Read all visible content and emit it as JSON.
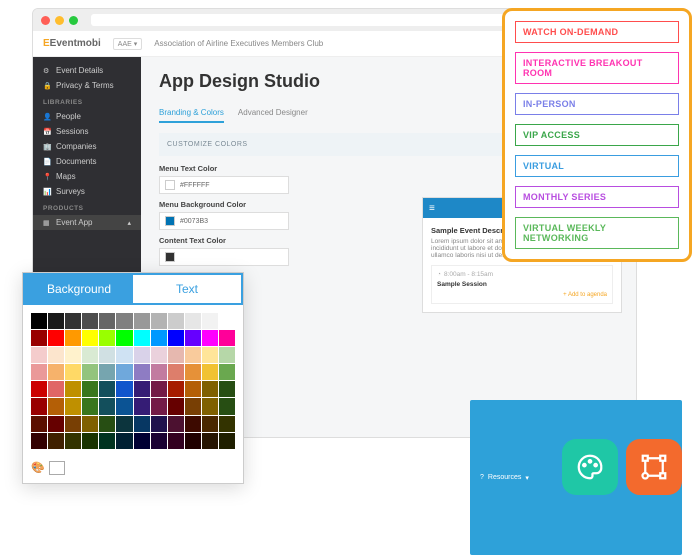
{
  "window": {
    "brand": "Eventmobi",
    "select": "AAE",
    "breadcrumb": "Association of Airline Executives Members Club"
  },
  "sidebar": {
    "items": [
      {
        "icon": "⚙",
        "label": "Event Details"
      },
      {
        "icon": "🔒",
        "label": "Privacy & Terms"
      }
    ],
    "sect1": "LIBRARIES",
    "lib": [
      {
        "icon": "👤",
        "label": "People"
      },
      {
        "icon": "📅",
        "label": "Sessions"
      },
      {
        "icon": "🏢",
        "label": "Companies"
      },
      {
        "icon": "📄",
        "label": "Documents"
      },
      {
        "icon": "📍",
        "label": "Maps"
      },
      {
        "icon": "📊",
        "label": "Surveys"
      }
    ],
    "sect2": "PRODUCTS",
    "prod": {
      "icon": "▦",
      "label": "Event App"
    }
  },
  "main": {
    "title": "App Design Studio",
    "tabs": [
      "Branding & Colors",
      "Advanced Designer"
    ],
    "panel": "CUSTOMIZE COLORS",
    "fields": [
      {
        "label": "Menu Text Color",
        "swatch": "#ffffff",
        "value": "#FFFFFF"
      },
      {
        "label": "Menu Background Color",
        "swatch": "#0073B3",
        "value": "#0073B3"
      },
      {
        "label": "Content Text Color",
        "swatch": "#333333",
        "value": ""
      }
    ]
  },
  "preview": {
    "title": "Sample Event Description",
    "lorem": "Lorem ipsum dolor sit amet, consectetur adipisicing elit, incididunt ut labore et dolore magna aliqua minim, exercitation ullamco laboris nisi ut de.",
    "time": "8:00am - 8:15am",
    "session": "Sample Session",
    "more": "+ Add to agenda"
  },
  "resources": "Resources",
  "picker": {
    "tab_a": "Background",
    "tab_b": "Text",
    "colors": [
      "#000000",
      "#1a1a1a",
      "#333333",
      "#4d4d4d",
      "#666666",
      "#808080",
      "#999999",
      "#b3b3b3",
      "#cccccc",
      "#e6e6e6",
      "#f2f2f2",
      "#ffffff",
      "#990000",
      "#ff0000",
      "#ff9900",
      "#ffff00",
      "#99ff00",
      "#00ff00",
      "#00ffff",
      "#0099ff",
      "#0000ff",
      "#6600ff",
      "#ff00ff",
      "#ff0099",
      "#f4cccc",
      "#fce5cd",
      "#fff2cc",
      "#d9ead3",
      "#d0e0e3",
      "#cfe2f3",
      "#d9d2e9",
      "#ead1dc",
      "#e6b8af",
      "#f9cb9c",
      "#ffe599",
      "#b6d7a8",
      "#ea9999",
      "#f6b26b",
      "#ffd966",
      "#93c47d",
      "#76a5af",
      "#6fa8dc",
      "#8e7cc3",
      "#c27ba0",
      "#dd7e6b",
      "#e69138",
      "#f1c232",
      "#6aa84f",
      "#cc0000",
      "#e06666",
      "#bf9000",
      "#38761d",
      "#134f5c",
      "#1155cc",
      "#351c75",
      "#741b47",
      "#a61c00",
      "#b45f06",
      "#7f6000",
      "#274e13",
      "#990000",
      "#b45f06",
      "#bf9000",
      "#38761d",
      "#134f5c",
      "#0b5394",
      "#351c75",
      "#741b47",
      "#660000",
      "#783f04",
      "#7f6000",
      "#274e13",
      "#5b0f00",
      "#660000",
      "#783f04",
      "#7f6000",
      "#274e13",
      "#0c343d",
      "#073763",
      "#20124d",
      "#4c1130",
      "#3d0a00",
      "#4a2800",
      "#333300",
      "#330000",
      "#402000",
      "#333300",
      "#1a3300",
      "#003320",
      "#002033",
      "#000033",
      "#1a0033",
      "#330020",
      "#200000",
      "#261400",
      "#1f1f00"
    ]
  },
  "pills": [
    {
      "label": "WATCH ON-DEMAND",
      "color": "#ff4d4d"
    },
    {
      "label": "INTERACTIVE BREAKOUT ROOM",
      "color": "#ff33b1"
    },
    {
      "label": "IN-PERSON",
      "color": "#7a7fe8"
    },
    {
      "label": "VIP ACCESS",
      "color": "#3aa64a"
    },
    {
      "label": "VIRTUAL",
      "color": "#3a9de0"
    },
    {
      "label": "MONTHLY SERIES",
      "color": "#b84de0"
    },
    {
      "label": "VIRTUAL WEEKLY NETWORKING",
      "color": "#5ab85a"
    }
  ]
}
